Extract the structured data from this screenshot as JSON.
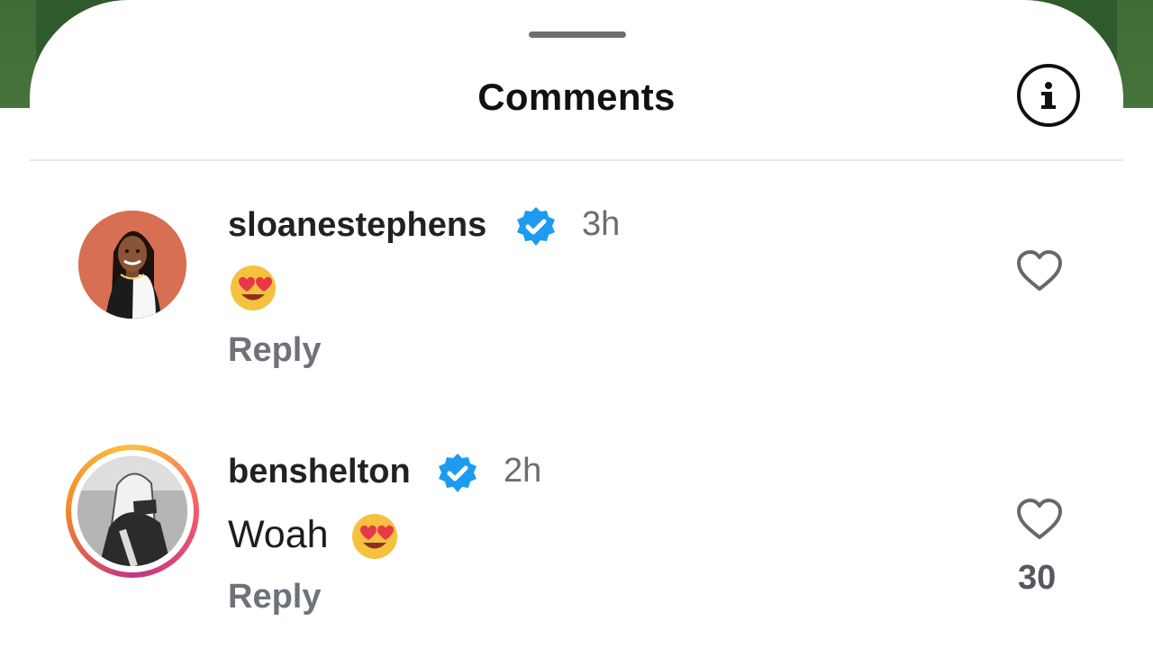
{
  "header": {
    "title": "Comments"
  },
  "comments": [
    {
      "username": "sloanestephens",
      "time": "3h",
      "text": "",
      "reply_label": "Reply",
      "like_count": ""
    },
    {
      "username": "benshelton",
      "time": "2h",
      "text": "Woah",
      "reply_label": "Reply",
      "like_count": "30"
    }
  ],
  "icons": {
    "info": "info-icon",
    "verified": "verified-badge-icon",
    "heart": "heart-icon",
    "emoji": "heart-eyes-emoji"
  },
  "colors": {
    "verified_blue": "#1d9bf0",
    "text_dark": "#222222",
    "meta_gray": "#6d6d6d"
  }
}
